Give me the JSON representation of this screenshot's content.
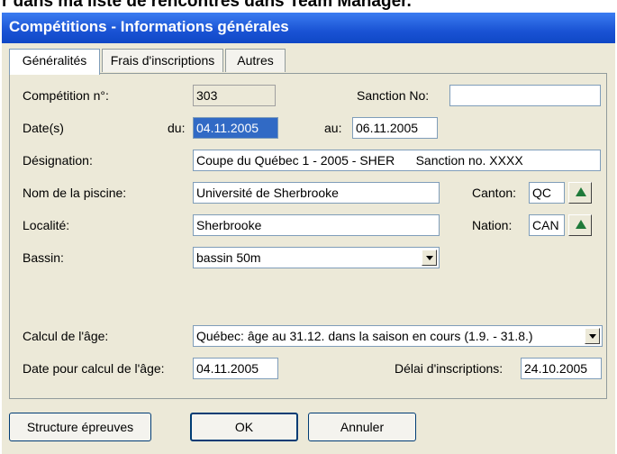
{
  "page_caption": "r dans ma liste de rencontres dans Team Manager.",
  "window": {
    "title": "Compétitions - Informations générales"
  },
  "tabs": [
    {
      "label": "Généralités",
      "active": true
    },
    {
      "label": "Frais d'inscriptions",
      "active": false
    },
    {
      "label": "Autres",
      "active": false
    }
  ],
  "form": {
    "competition_no": {
      "label": "Compétition n°:",
      "value": "303"
    },
    "sanction_no": {
      "label": "Sanction No:",
      "value": ""
    },
    "dates": {
      "label": "Date(s)",
      "from_label": "du:",
      "from_value": "04.11.2005",
      "to_label": "au:",
      "to_value": "06.11.2005"
    },
    "designation": {
      "label": "Désignation:",
      "value": "Coupe du Québec 1 - 2005 - SHER      Sanction no. XXXX"
    },
    "pool_name": {
      "label": "Nom de la piscine:",
      "value": "Université de Sherbrooke"
    },
    "canton": {
      "label": "Canton:",
      "value": "QC"
    },
    "locality": {
      "label": "Localité:",
      "value": "Sherbrooke"
    },
    "nation": {
      "label": "Nation:",
      "value": "CAN"
    },
    "basin": {
      "label": "Bassin:",
      "value": "bassin 50m"
    },
    "age_calc": {
      "label": "Calcul de l'âge:",
      "value": "Québec: âge au 31.12. dans la saison en cours (1.9. - 31.8.)"
    },
    "age_date": {
      "label": "Date pour calcul de l'âge:",
      "value": "04.11.2005"
    },
    "entry_deadline": {
      "label": "Délai d'inscriptions:",
      "value": "24.10.2005"
    }
  },
  "buttons": {
    "structure": "Structure épreuves",
    "ok": "OK",
    "cancel": "Annuler"
  },
  "icons": {
    "up_arrow": "green-up-arrow-icon",
    "dropdown": "chevron-down-icon"
  },
  "colors": {
    "titlebar": "#1a53d4",
    "selection": "#316ac5",
    "arrow": "#1f7a3a"
  }
}
